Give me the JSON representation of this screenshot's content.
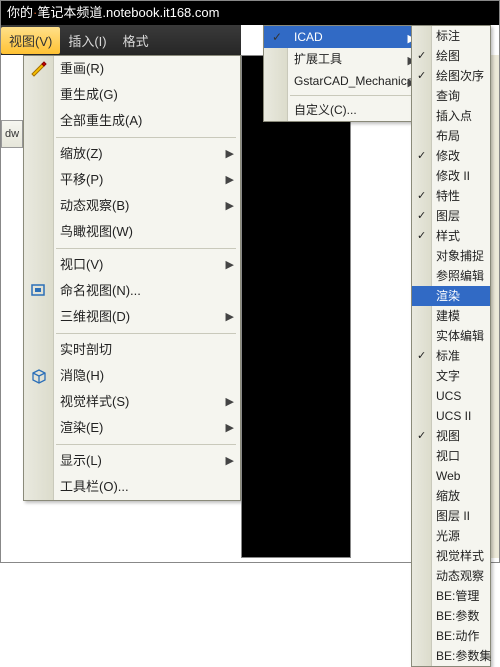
{
  "breadcrumb": {
    "text1": "你的",
    "text2": "笔记本频道",
    "url": ".notebook.it168.com"
  },
  "menubar": {
    "active": "视图(V)",
    "insert": "插入(I)",
    "format": "格式"
  },
  "left_tab": "dw",
  "left_menu": {
    "redraw": "重画(R)",
    "regen": "重生成(G)",
    "regen_all": "全部重生成(A)",
    "zoom": "缩放(Z)",
    "pan": "平移(P)",
    "orbit": "动态观察(B)",
    "aerial": "鸟瞰视图(W)",
    "viewport": "视口(V)",
    "named_view": "命名视图(N)...",
    "view3d": "三维视图(D)",
    "realtime_cut": "实时剖切",
    "hide": "消隐(H)",
    "visual_style": "视觉样式(S)",
    "render": "渲染(E)",
    "display": "显示(L)",
    "toolbar": "工具栏(O)..."
  },
  "right_parent": {
    "icad": "ICAD",
    "ext": "扩展工具",
    "gstar": "GstarCAD_Mechanical",
    "custom": "自定义(C)..."
  },
  "right_sub": [
    {
      "label": "标注",
      "check": false
    },
    {
      "label": "绘图",
      "check": true
    },
    {
      "label": "绘图次序",
      "check": true
    },
    {
      "label": "查询",
      "check": false
    },
    {
      "label": "插入点",
      "check": false
    },
    {
      "label": "布局",
      "check": false
    },
    {
      "label": "修改",
      "check": true
    },
    {
      "label": "修改 II",
      "check": false
    },
    {
      "label": "特性",
      "check": true
    },
    {
      "label": "图层",
      "check": true
    },
    {
      "label": "样式",
      "check": true
    },
    {
      "label": "对象捕捉",
      "check": false
    },
    {
      "label": "参照编辑",
      "check": false
    },
    {
      "label": "渲染",
      "check": false,
      "hl": true
    },
    {
      "label": "建模",
      "check": false
    },
    {
      "label": "实体编辑",
      "check": false
    },
    {
      "label": "标准",
      "check": true
    },
    {
      "label": "文字",
      "check": false
    },
    {
      "label": "UCS",
      "check": false
    },
    {
      "label": "UCS II",
      "check": false
    },
    {
      "label": "视图",
      "check": true
    },
    {
      "label": "视口",
      "check": false
    },
    {
      "label": "Web",
      "check": false
    },
    {
      "label": "缩放",
      "check": false
    },
    {
      "label": "图层 II",
      "check": false
    },
    {
      "label": "光源",
      "check": false
    },
    {
      "label": "视觉样式",
      "check": false
    },
    {
      "label": "动态观察",
      "check": false
    },
    {
      "label": "BE:管理",
      "check": false
    },
    {
      "label": "BE:参数",
      "check": false
    },
    {
      "label": "BE:动作",
      "check": false
    },
    {
      "label": "BE:参数集",
      "check": false
    }
  ]
}
